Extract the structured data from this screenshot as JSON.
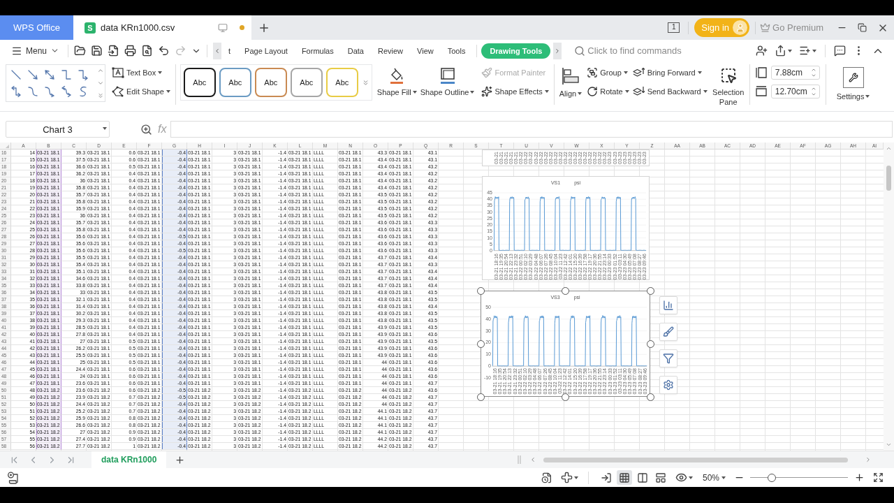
{
  "title_bar": {
    "app_tab": "WPS Office",
    "document_tab": {
      "badge": "S",
      "name": "data KRn1000.csv",
      "modified": true
    },
    "window_count": "1",
    "sign_in": "Sign in",
    "premium": "Go Premium"
  },
  "toolbar": {
    "menu": "Menu",
    "redo": {
      "disabled": true
    },
    "tabs": [
      {
        "label": "t",
        "selected": false
      },
      {
        "label": "Page Layout",
        "selected": false
      },
      {
        "label": "Formulas",
        "selected": false
      },
      {
        "label": "Data",
        "selected": false
      },
      {
        "label": "Review",
        "selected": false
      },
      {
        "label": "View",
        "selected": false
      },
      {
        "label": "Tools",
        "selected": false
      },
      {
        "label": "Drawing Tools",
        "selected": true
      }
    ],
    "search": {
      "placeholder": "Click to find commands"
    }
  },
  "ribbon": {
    "text_box": "Text Box",
    "edit_shape": "Edit Shape",
    "shape_styles": [
      {
        "label": "Abc",
        "color": "#1a1a1a"
      },
      {
        "label": "Abc",
        "color": "#6b9bc3"
      },
      {
        "label": "Abc",
        "color": "#c98a52"
      },
      {
        "label": "Abc",
        "color": "#a6a6a6"
      },
      {
        "label": "Abc",
        "color": "#e8cc45"
      }
    ],
    "shape_fill": "Shape Fill",
    "shape_outline": "Shape Outline",
    "format_painter": {
      "label": "Format Painter",
      "disabled": true
    },
    "shape_effects": "Shape Effects",
    "align": "Align",
    "group": "Group",
    "rotate": "Rotate",
    "bring_forward": "Bring Forward",
    "send_backward": "Send Backward",
    "selection_pane": "Selection Pane",
    "height": "7.88cm",
    "width": "12.70cm",
    "settings": "Settings"
  },
  "formula_bar": {
    "name_box": "Chart 3",
    "function_label": "fx"
  },
  "sheet": {
    "column_headers": [
      "A",
      "B",
      "C",
      "D",
      "E",
      "F",
      "G",
      "H",
      "I",
      "J",
      "K",
      "L",
      "M",
      "N",
      "O",
      "P",
      "Q",
      "R",
      "S",
      "T",
      "U",
      "V",
      "W",
      "X",
      "Y",
      "Z",
      "AA",
      "AB",
      "AC",
      "AD",
      "AE",
      "AF",
      "AG",
      "AH",
      "AI"
    ],
    "column_formats": [
      {
        "kind": "number",
        "highlighted": false
      },
      {
        "kind": "text",
        "highlighted": true,
        "color": "#b48ad6"
      },
      {
        "kind": "number",
        "highlighted": false
      },
      {
        "kind": "text",
        "highlighted": false
      },
      {
        "kind": "number",
        "highlighted": false
      },
      {
        "kind": "text",
        "highlighted": false
      },
      {
        "kind": "number",
        "highlighted": true,
        "color": "#5b7fc7"
      },
      {
        "kind": "text",
        "highlighted": false
      },
      {
        "kind": "number",
        "highlighted": false
      },
      {
        "kind": "text",
        "highlighted": false
      },
      {
        "kind": "number",
        "highlighted": false
      },
      {
        "kind": "text",
        "highlighted": false
      },
      {
        "kind": "text",
        "highlighted": false
      },
      {
        "kind": "text",
        "highlighted": false
      },
      {
        "kind": "number",
        "highlighted": false
      },
      {
        "kind": "text",
        "highlighted": false
      },
      {
        "kind": "number",
        "highlighted": false
      }
    ],
    "rows": [
      {
        "number": "16",
        "cells": [
          "14",
          "03-21 18.1",
          "39.3",
          "03-21 18.1",
          "0.6",
          "03-21 18.1",
          "-0.4",
          "03-21 18.1",
          "3",
          "03-21 18.1",
          "-1.4",
          "03-21 18.1",
          "LLLL",
          "03-21 18.1",
          "43.3",
          "03-21 18.1",
          "43.1"
        ]
      },
      {
        "number": "17",
        "cells": [
          "15",
          "03-21 18.1",
          "37.5",
          "03-21 18.1",
          "0.6",
          "03-21 18.1",
          "-0.4",
          "03-21 18.1",
          "3",
          "03-21 18.1",
          "-1.4",
          "03-21 18.1",
          "LLLL",
          "03-21 18.1",
          "43.4",
          "03-21 18.1",
          "43.1"
        ]
      },
      {
        "number": "18",
        "cells": [
          "16",
          "03-21 18.1",
          "36.6",
          "03-21 18.1",
          "0.5",
          "03-21 18.1",
          "-0.4",
          "03-21 18.1",
          "3",
          "03-21 18.1",
          "-1.4",
          "03-21 18.1",
          "LLLL",
          "03-21 18.1",
          "43.4",
          "03-21 18.1",
          "43.2"
        ]
      },
      {
        "number": "19",
        "cells": [
          "17",
          "03-21 18.1",
          "36.2",
          "03-21 18.1",
          "0.4",
          "03-21 18.1",
          "-0.4",
          "03-21 18.1",
          "3",
          "03-21 18.1",
          "-1.4",
          "03-21 18.1",
          "LLLL",
          "03-21 18.1",
          "43.4",
          "03-21 18.1",
          "43.2"
        ]
      },
      {
        "number": "20",
        "cells": [
          "18",
          "03-21 18.1",
          "36",
          "03-21 18.1",
          "0.4",
          "03-21 18.1",
          "-0.4",
          "03-21 18.1",
          "3",
          "03-21 18.1",
          "-1.4",
          "03-21 18.1",
          "LLLL",
          "03-21 18.1",
          "43.4",
          "03-21 18.1",
          "43.2"
        ]
      },
      {
        "number": "21",
        "cells": [
          "19",
          "03-21 18.1",
          "35.8",
          "03-21 18.1",
          "0.4",
          "03-21 18.1",
          "-0.4",
          "03-21 18.1",
          "3",
          "03-21 18.1",
          "-1.4",
          "03-21 18.1",
          "LLLL",
          "03-21 18.1",
          "43.4",
          "03-21 18.1",
          "43.2"
        ]
      },
      {
        "number": "22",
        "cells": [
          "20",
          "03-21 18.1",
          "35.7",
          "03-21 18.1",
          "0.4",
          "03-21 18.1",
          "-0.4",
          "03-21 18.1",
          "3",
          "03-21 18.1",
          "-1.4",
          "03-21 18.1",
          "LLLL",
          "03-21 18.1",
          "43.5",
          "03-21 18.1",
          "43.2"
        ]
      },
      {
        "number": "23",
        "cells": [
          "21",
          "03-21 18.1",
          "35.8",
          "03-21 18.1",
          "0.4",
          "03-21 18.1",
          "-0.4",
          "03-21 18.1",
          "3",
          "03-21 18.1",
          "-1.4",
          "03-21 18.1",
          "LLLL",
          "03-21 18.1",
          "43.5",
          "03-21 18.1",
          "43.2"
        ]
      },
      {
        "number": "24",
        "cells": [
          "22",
          "03-21 18.1",
          "35.9",
          "03-21 18.1",
          "0.4",
          "03-21 18.1",
          "-0.4",
          "03-21 18.1",
          "3",
          "03-21 18.1",
          "-1.4",
          "03-21 18.1",
          "LLLL",
          "03-21 18.1",
          "43.5",
          "03-21 18.1",
          "43.2"
        ]
      },
      {
        "number": "25",
        "cells": [
          "23",
          "03-21 18.1",
          "36",
          "03-21 18.1",
          "0.4",
          "03-21 18.1",
          "-0.4",
          "03-21 18.1",
          "3",
          "03-21 18.1",
          "-1.4",
          "03-21 18.1",
          "LLLL",
          "03-21 18.1",
          "43.5",
          "03-21 18.1",
          "43.2"
        ]
      },
      {
        "number": "26",
        "cells": [
          "24",
          "03-21 18.1",
          "35.7",
          "03-21 18.1",
          "0.4",
          "03-21 18.1",
          "-0.4",
          "03-21 18.1",
          "3",
          "03-21 18.1",
          "-1.4",
          "03-21 18.1",
          "LLLL",
          "03-21 18.1",
          "43.6",
          "03-21 18.1",
          "43.3"
        ]
      },
      {
        "number": "27",
        "cells": [
          "25",
          "03-21 18.1",
          "35.8",
          "03-21 18.1",
          "0.4",
          "03-21 18.1",
          "-0.4",
          "03-21 18.1",
          "3",
          "03-21 18.1",
          "-1.4",
          "03-21 18.1",
          "LLLL",
          "03-21 18.1",
          "43.6",
          "03-21 18.1",
          "43.3"
        ]
      },
      {
        "number": "28",
        "cells": [
          "26",
          "03-21 18.1",
          "35.6",
          "03-21 18.1",
          "0.4",
          "03-21 18.1",
          "-0.5",
          "03-21 18.1",
          "3",
          "03-21 18.1",
          "-1.4",
          "03-21 18.1",
          "LLLL",
          "03-21 18.1",
          "43.6",
          "03-21 18.1",
          "43.3"
        ]
      },
      {
        "number": "29",
        "cells": [
          "27",
          "03-21 18.1",
          "35.6",
          "03-21 18.1",
          "0.4",
          "03-21 18.1",
          "-0.4",
          "03-21 18.1",
          "3",
          "03-21 18.1",
          "-1.4",
          "03-21 18.1",
          "LLLL",
          "03-21 18.1",
          "43.6",
          "03-21 18.1",
          "43.3"
        ]
      },
      {
        "number": "30",
        "cells": [
          "28",
          "03-21 18.1",
          "35.6",
          "03-21 18.1",
          "0.4",
          "03-21 18.1",
          "-0.5",
          "03-21 18.1",
          "3",
          "03-21 18.1",
          "-1.4",
          "03-21 18.1",
          "LLLL",
          "03-21 18.1",
          "43.6",
          "03-21 18.1",
          "43.3"
        ]
      },
      {
        "number": "31",
        "cells": [
          "29",
          "03-21 18.1",
          "35.5",
          "03-21 18.1",
          "0.4",
          "03-21 18.1",
          "-0.4",
          "03-21 18.1",
          "3",
          "03-21 18.1",
          "-1.4",
          "03-21 18.1",
          "LLLL",
          "03-21 18.1",
          "43.7",
          "03-21 18.1",
          "43.4"
        ]
      },
      {
        "number": "32",
        "cells": [
          "30",
          "03-21 18.1",
          "35.4",
          "03-21 18.1",
          "0.4",
          "03-21 18.1",
          "-0.4",
          "03-21 18.1",
          "3",
          "03-21 18.1",
          "-1.4",
          "03-21 18.1",
          "LLLL",
          "03-21 18.1",
          "43.7",
          "03-21 18.1",
          "43.3"
        ]
      },
      {
        "number": "33",
        "cells": [
          "31",
          "03-21 18.1",
          "35.1",
          "03-21 18.1",
          "0.4",
          "03-21 18.1",
          "-0.4",
          "03-21 18.1",
          "3",
          "03-21 18.1",
          "-1.4",
          "03-21 18.1",
          "LLLL",
          "03-21 18.1",
          "43.7",
          "03-21 18.1",
          "43.4"
        ]
      },
      {
        "number": "34",
        "cells": [
          "32",
          "03-21 18.1",
          "34.6",
          "03-21 18.1",
          "0.4",
          "03-21 18.1",
          "-0.4",
          "03-21 18.1",
          "3",
          "03-21 18.1",
          "-1.4",
          "03-21 18.1",
          "LLLL",
          "03-21 18.1",
          "43.7",
          "03-21 18.1",
          "43.4"
        ]
      },
      {
        "number": "35",
        "cells": [
          "33",
          "03-21 18.1",
          "33.8",
          "03-21 18.1",
          "0.4",
          "03-21 18.1",
          "-0.4",
          "03-21 18.1",
          "3",
          "03-21 18.1",
          "-1.4",
          "03-21 18.1",
          "LLLL",
          "03-21 18.1",
          "43.7",
          "03-21 18.1",
          "43.4"
        ]
      },
      {
        "number": "36",
        "cells": [
          "34",
          "03-21 18.1",
          "33",
          "03-21 18.1",
          "0.4",
          "03-21 18.1",
          "-0.4",
          "03-21 18.1",
          "3",
          "03-21 18.1",
          "-1.4",
          "03-21 18.1",
          "LLLL",
          "03-21 18.1",
          "43.8",
          "03-21 18.1",
          "43.5"
        ]
      },
      {
        "number": "37",
        "cells": [
          "35",
          "03-21 18.1",
          "32.1",
          "03-21 18.1",
          "0.4",
          "03-21 18.1",
          "-0.4",
          "03-21 18.1",
          "3",
          "03-21 18.1",
          "-1.4",
          "03-21 18.1",
          "LLLL",
          "03-21 18.1",
          "43.8",
          "03-21 18.1",
          "43.5"
        ]
      },
      {
        "number": "38",
        "cells": [
          "36",
          "03-21 18.1",
          "31.4",
          "03-21 18.1",
          "0.4",
          "03-21 18.1",
          "-0.4",
          "03-21 18.1",
          "3",
          "03-21 18.1",
          "-1.4",
          "03-21 18.1",
          "LLLL",
          "03-21 18.1",
          "43.8",
          "03-21 18.1",
          "43.4"
        ]
      },
      {
        "number": "39",
        "cells": [
          "37",
          "03-21 18.1",
          "30.2",
          "03-21 18.1",
          "0.4",
          "03-21 18.1",
          "-0.4",
          "03-21 18.1",
          "3",
          "03-21 18.1",
          "-1.4",
          "03-21 18.1",
          "LLLL",
          "03-21 18.1",
          "43.8",
          "03-21 18.1",
          "43.5"
        ]
      },
      {
        "number": "40",
        "cells": [
          "38",
          "03-21 18.1",
          "29.3",
          "03-21 18.1",
          "0.4",
          "03-21 18.1",
          "-0.4",
          "03-21 18.1",
          "3",
          "03-21 18.1",
          "-1.4",
          "03-21 18.1",
          "LLLL",
          "03-21 18.1",
          "43.8",
          "03-21 18.1",
          "43.5"
        ]
      },
      {
        "number": "41",
        "cells": [
          "39",
          "03-21 18.1",
          "28.5",
          "03-21 18.1",
          "0.4",
          "03-21 18.1",
          "-0.4",
          "03-21 18.1",
          "3",
          "03-21 18.1",
          "-1.4",
          "03-21 18.1",
          "LLLL",
          "03-21 18.1",
          "43.9",
          "03-21 18.1",
          "43.5"
        ]
      },
      {
        "number": "42",
        "cells": [
          "40",
          "03-21 18.1",
          "27.8",
          "03-21 18.1",
          "0.4",
          "03-21 18.1",
          "-0.4",
          "03-21 18.1",
          "3",
          "03-21 18.1",
          "-1.4",
          "03-21 18.1",
          "LLLL",
          "03-21 18.1",
          "43.9",
          "03-21 18.1",
          "43.6"
        ]
      },
      {
        "number": "43",
        "cells": [
          "41",
          "03-21 18.1",
          "27",
          "03-21 18.1",
          "0.5",
          "03-21 18.1",
          "-0.4",
          "03-21 18.1",
          "3",
          "03-21 18.1",
          "-1.4",
          "03-21 18.1",
          "LLLL",
          "03-21 18.1",
          "43.9",
          "03-21 18.1",
          "43.5"
        ]
      },
      {
        "number": "44",
        "cells": [
          "42",
          "03-21 18.1",
          "26.2",
          "03-21 18.1",
          "0.5",
          "03-21 18.1",
          "-0.4",
          "03-21 18.1",
          "3",
          "03-21 18.1",
          "-1.4",
          "03-21 18.1",
          "LLLL",
          "03-21 18.1",
          "43.9",
          "03-21 18.1",
          "43.6"
        ]
      },
      {
        "number": "45",
        "cells": [
          "43",
          "03-21 18.1",
          "25.5",
          "03-21 18.1",
          "0.5",
          "03-21 18.1",
          "-0.4",
          "03-21 18.1",
          "3",
          "03-21 18.1",
          "-1.4",
          "03-21 18.1",
          "LLLL",
          "03-21 18.1",
          "43.9",
          "03-21 18.1",
          "43.6"
        ]
      },
      {
        "number": "46",
        "cells": [
          "44",
          "03-21 18.1",
          "25",
          "03-21 18.1",
          "0.5",
          "03-21 18.1",
          "-0.4",
          "03-21 18.1",
          "3",
          "03-21 18.1",
          "-1.4",
          "03-21 18.1",
          "LLLL",
          "03-21 18.1",
          "44",
          "03-21 18.1",
          "43.6"
        ]
      },
      {
        "number": "47",
        "cells": [
          "45",
          "03-21 18.1",
          "24.4",
          "03-21 18.1",
          "0.6",
          "03-21 18.1",
          "-0.4",
          "03-21 18.1",
          "3",
          "03-21 18.1",
          "-1.4",
          "03-21 18.1",
          "LLLL",
          "03-21 18.1",
          "44",
          "03-21 18.1",
          "43.6"
        ]
      },
      {
        "number": "48",
        "cells": [
          "46",
          "03-21 18.1",
          "24",
          "03-21 18.1",
          "0.6",
          "03-21 18.1",
          "-0.4",
          "03-21 18.1",
          "3",
          "03-21 18.1",
          "-1.4",
          "03-21 18.1",
          "LLLL",
          "03-21 18.1",
          "44",
          "03-21 18.1",
          "43.6"
        ]
      },
      {
        "number": "49",
        "cells": [
          "47",
          "03-21 18.1",
          "23.6",
          "03-21 18.1",
          "0.6",
          "03-21 18.1",
          "-0.4",
          "03-21 18.1",
          "3",
          "03-21 18.1",
          "-1.4",
          "03-21 18.1",
          "LLLL",
          "03-21 18.1",
          "44",
          "03-21 18.1",
          "43.7"
        ]
      },
      {
        "number": "50",
        "cells": [
          "48",
          "03-21 18.2",
          "23.6",
          "03-21 18.2",
          "0.6",
          "03-21 18.2",
          "-0.5",
          "03-21 18.2",
          "3",
          "03-21 18.2",
          "-1.4",
          "03-21 18.2",
          "LLLL",
          "03-21 18.2",
          "44",
          "03-21 18.2",
          "43.6"
        ]
      },
      {
        "number": "51",
        "cells": [
          "49",
          "03-21 18.2",
          "23.9",
          "03-21 18.2",
          "0.7",
          "03-21 18.2",
          "-0.5",
          "03-21 18.2",
          "3",
          "03-21 18.2",
          "-1.4",
          "03-21 18.2",
          "LLLL",
          "03-21 18.2",
          "44",
          "03-21 18.2",
          "43.7"
        ]
      },
      {
        "number": "52",
        "cells": [
          "50",
          "03-21 18.2",
          "24.4",
          "03-21 18.2",
          "0.7",
          "03-21 18.2",
          "-0.4",
          "03-21 18.2",
          "3",
          "03-21 18.2",
          "-1.4",
          "03-21 18.2",
          "LLLL",
          "03-21 18.2",
          "44",
          "03-21 18.2",
          "43.7"
        ]
      },
      {
        "number": "53",
        "cells": [
          "51",
          "03-21 18.2",
          "25.2",
          "03-21 18.2",
          "0.7",
          "03-21 18.2",
          "-0.4",
          "03-21 18.2",
          "3",
          "03-21 18.2",
          "-1.4",
          "03-21 18.2",
          "LLLL",
          "03-21 18.2",
          "44.1",
          "03-21 18.2",
          "43.7"
        ]
      },
      {
        "number": "54",
        "cells": [
          "52",
          "03-21 18.2",
          "25.9",
          "03-21 18.2",
          "0.8",
          "03-21 18.2",
          "-0.4",
          "03-21 18.2",
          "3",
          "03-21 18.2",
          "-1.4",
          "03-21 18.2",
          "LLLL",
          "03-21 18.2",
          "44.1",
          "03-21 18.2",
          "43.7"
        ]
      },
      {
        "number": "55",
        "cells": [
          "53",
          "03-21 18.2",
          "26.6",
          "03-21 18.2",
          "0.8",
          "03-21 18.2",
          "-0.4",
          "03-21 18.2",
          "3",
          "03-21 18.2",
          "-1.4",
          "03-21 18.2",
          "LLLL",
          "03-21 18.2",
          "44.1",
          "03-21 18.2",
          "43.7"
        ]
      },
      {
        "number": "56",
        "cells": [
          "54",
          "03-21 18.2",
          "27",
          "03-21 18.2",
          "0.9",
          "03-21 18.2",
          "-0.4",
          "03-21 18.2",
          "3",
          "03-21 18.2",
          "-1.4",
          "03-21 18.2",
          "LLLL",
          "03-21 18.2",
          "44.1",
          "03-21 18.2",
          "43.7"
        ]
      },
      {
        "number": "57",
        "cells": [
          "55",
          "03-21 18.2",
          "27.4",
          "03-21 18.2",
          "0.9",
          "03-21 18.2",
          "-0.4",
          "03-21 18.2",
          "3",
          "03-21 18.2",
          "-1.4",
          "03-21 18.2",
          "LLLL",
          "03-21 18.2",
          "44.2",
          "03-21 18.2",
          "43.7"
        ]
      },
      {
        "number": "58",
        "cells": [
          "56",
          "03-21 18.2",
          "27.7",
          "03-21 18.2",
          "1",
          "03-21 18.2",
          "-0.4",
          "03-21 18.2",
          "3",
          "03-21 18.2",
          "-1.4",
          "03-21 18.2",
          "LLLL",
          "03-21 18.2",
          "44.2",
          "03-21 18.2",
          "43.7"
        ]
      }
    ]
  },
  "charts": [
    {
      "kind": "cut_off",
      "selected": false,
      "x_labels": [
        "03-21",
        "03-21",
        "03-21",
        "03-21",
        "03-21",
        "03-22",
        "03-22",
        "03-22",
        "03-22",
        "03-22",
        "03-22",
        "03-22",
        "03-22",
        "03-22",
        "03-22",
        "03-22",
        "03-22",
        "03-22",
        "03-22",
        "03-22",
        "03-22",
        "03-22",
        "03-22",
        "03-23",
        "03-23",
        "03-23",
        "03-23",
        "03-23",
        "03-23",
        "03-23",
        "03-23"
      ]
    },
    {
      "kind": "line",
      "title": "VS1",
      "unit": "psi",
      "selected": false,
      "y_ticks": [
        "45",
        "40",
        "35",
        "30",
        "25",
        "20",
        "15",
        "10",
        "5",
        "0"
      ],
      "x_labels": [
        "03-21 18:16",
        "03-21 19:35",
        "03-21 20:54",
        "03-21 22:13",
        "03-21 23:32",
        "03-22 00:51",
        "03-22 02:10",
        "03-22 03:29",
        "03-22 04:48",
        "03-22 06:07",
        "03-22 07:26",
        "03-22 08:45",
        "03-22 10:04",
        "03-22 11:23",
        "03-22 12:42",
        "03-22 14:01",
        "03-22 15:20",
        "03-22 16:39",
        "03-22 17:58",
        "03-22 19:17",
        "03-22 20:36",
        "03-22 21:55",
        "03-22 23:14",
        "03-23 00:33",
        "03-23 01:52",
        "03-23 03:11",
        "03-23 04:30",
        "03-23 05:49",
        "03-23 07:08",
        "03-23 08:27",
        "03-23 09:46"
      ]
    },
    {
      "kind": "line",
      "title": "VS3",
      "unit": "psi",
      "selected": true,
      "y_ticks": [
        "50",
        "40",
        "30",
        "20",
        "10",
        "0",
        "-10"
      ],
      "x_labels": [
        "03-21 18:16",
        "03-21 19:35",
        "03-21 20:54",
        "03-21 22:13",
        "03-21 23:32",
        "03-22 00:51",
        "03-22 02:10",
        "03-22 03:29",
        "03-22 04:48",
        "03-22 06:07",
        "03-22 07:26",
        "03-22 08:45",
        "03-22 10:04",
        "03-22 11:23",
        "03-22 12:42",
        "03-22 14:01",
        "03-22 15:20",
        "03-22 16:39",
        "03-22 17:58",
        "03-22 19:17",
        "03-22 20:36",
        "03-22 21:55",
        "03-22 23:14",
        "03-23 00:33",
        "03-23 01:52",
        "03-23 03:11",
        "03-23 04:30",
        "03-23 05:49",
        "03-23 07:08",
        "03-23 08:27",
        "03-23 09:46"
      ]
    }
  ],
  "sheet_tabs": [
    {
      "label": "data KRn1000",
      "selected": true
    }
  ],
  "status_bar": {
    "view_buttons": [
      {
        "selected": false
      },
      {
        "selected": true
      },
      {
        "selected": false
      },
      {
        "selected": false
      }
    ],
    "zoom": "50%",
    "zoom_slider": {
      "level": 0.22
    }
  }
}
